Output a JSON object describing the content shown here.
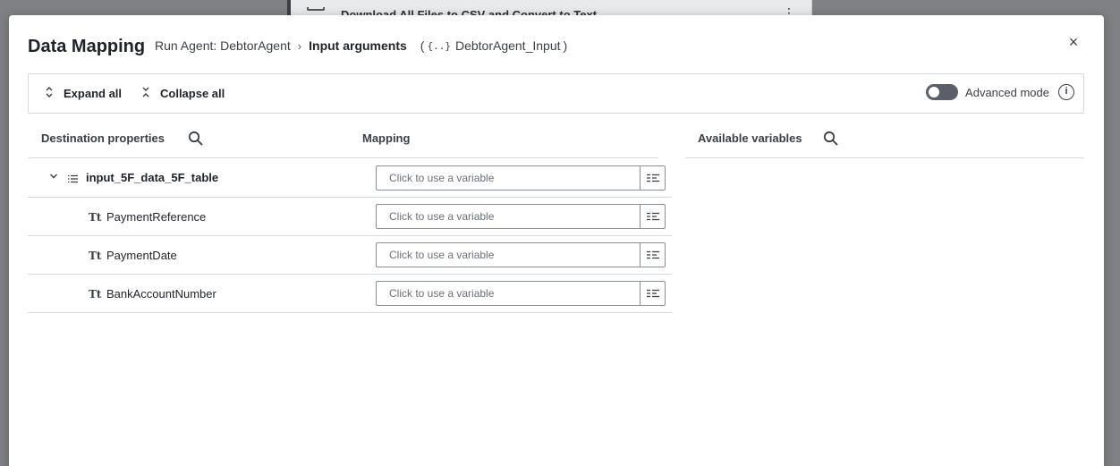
{
  "background": {
    "card_title": "Download All Files to CSV and Convert to Text"
  },
  "dialog": {
    "title": "Data Mapping",
    "breadcrumb": {
      "parent": "Run Agent: DebtorAgent",
      "current": "Input arguments",
      "type_name": "DebtorAgent_Input",
      "type_icon": "{..}"
    },
    "close_label": "×"
  },
  "toolbar": {
    "expand_all": "Expand all",
    "collapse_all": "Collapse all",
    "advanced_mode": "Advanced mode",
    "advanced_mode_enabled": false
  },
  "columns": {
    "destination": "Destination properties",
    "mapping": "Mapping",
    "available": "Available variables"
  },
  "rows": [
    {
      "name": "input_5F_data_5F_table",
      "kind": "list",
      "expanded": true,
      "placeholder": "Click to use a variable"
    },
    {
      "name": "PaymentReference",
      "kind": "text",
      "type_icon": "Tt",
      "placeholder": "Click to use a variable"
    },
    {
      "name": "PaymentDate",
      "kind": "text",
      "type_icon": "Tt",
      "placeholder": "Click to use a variable"
    },
    {
      "name": "BankAccountNumber",
      "kind": "text",
      "type_icon": "Tt",
      "placeholder": "Click to use a variable"
    }
  ],
  "colors": {
    "toggle_off": "#5b6068",
    "border": "#d5d8dc",
    "input_border": "#8a8f96",
    "text_primary": "#1f2329"
  }
}
